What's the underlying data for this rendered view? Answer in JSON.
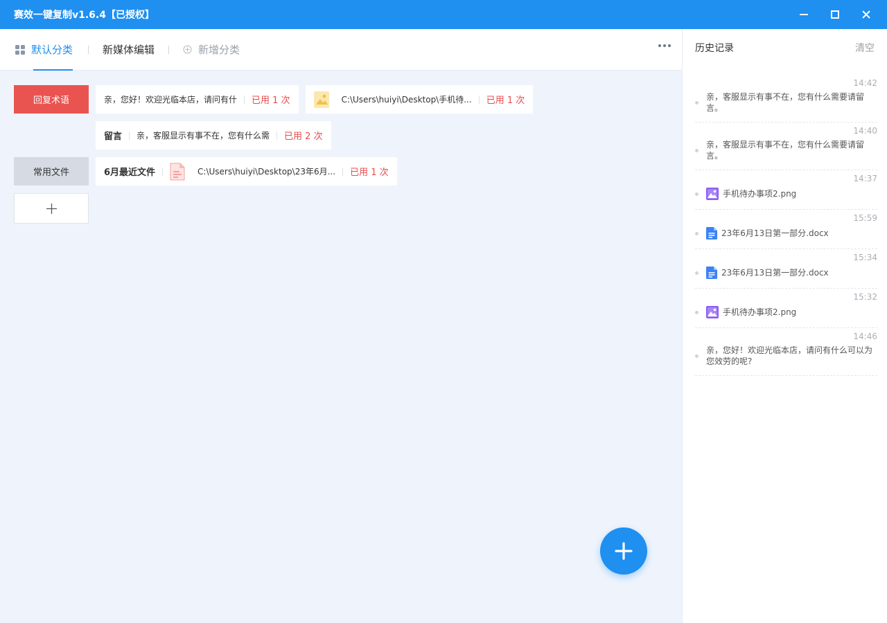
{
  "window": {
    "title": "赛效一键复制v1.6.4【已授权】",
    "accent": "#1f8ff0"
  },
  "tabs": {
    "default": "默认分类",
    "media": "新媒体编辑",
    "add": "新增分类"
  },
  "categories": {
    "reply": {
      "label": "回复术语",
      "items": [
        {
          "text": "亲，您好！欢迎光临本店，请问有什",
          "used": "已用 1 次"
        },
        {
          "path": "C:\\Users\\huiyi\\Desktop\\手机待...",
          "used": "已用 1 次",
          "icon": "image-file-icon"
        },
        {
          "name": "留言",
          "text": "亲，客服显示有事不在，您有什么需",
          "used": "已用 2 次"
        }
      ]
    },
    "files": {
      "label": "常用文件",
      "items": [
        {
          "name": "6月最近文件",
          "path": "C:\\Users\\huiyi\\Desktop\\23年6月...",
          "used": "已用 1 次",
          "icon": "document-file-icon"
        }
      ]
    }
  },
  "history": {
    "title": "历史记录",
    "clear": "清空",
    "items": [
      {
        "time": "14:42",
        "text": "亲，客服显示有事不在，您有什么需要请留言。",
        "type": "text"
      },
      {
        "time": "14:40",
        "text": "亲，客服显示有事不在，您有什么需要请留言。",
        "type": "text"
      },
      {
        "time": "14:37",
        "text": "手机待办事项2.png",
        "type": "image"
      },
      {
        "time": "15:59",
        "text": "23年6月13日第一部分.docx",
        "type": "doc"
      },
      {
        "time": "15:34",
        "text": "23年6月13日第一部分.docx",
        "type": "doc"
      },
      {
        "time": "15:32",
        "text": "手机待办事项2.png",
        "type": "image"
      },
      {
        "time": "14:46",
        "text": "亲，您好！欢迎光临本店，请问有什么可以为您效劳的呢?",
        "type": "text"
      }
    ]
  }
}
